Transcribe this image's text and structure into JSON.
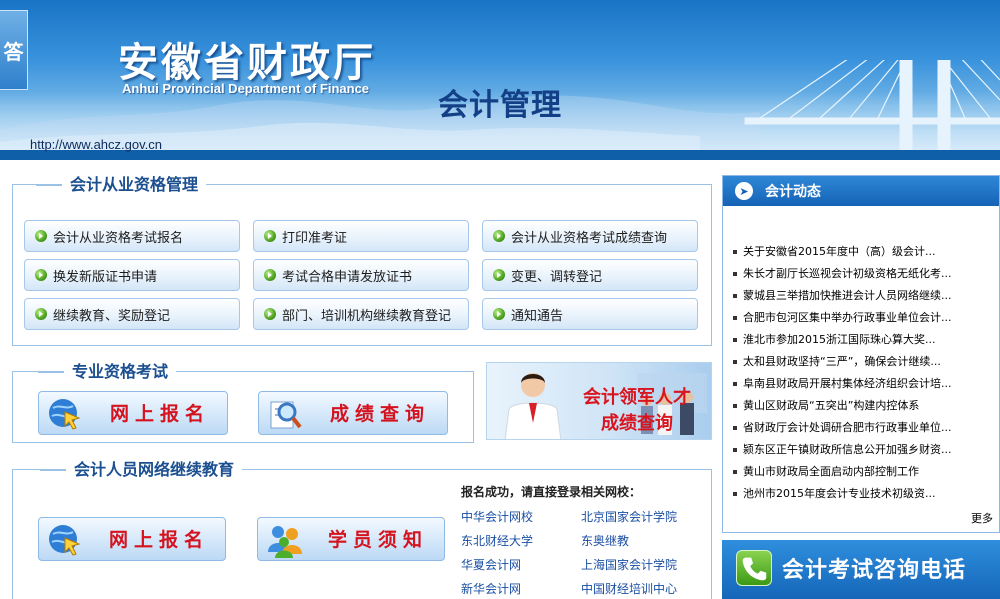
{
  "header": {
    "side_tab": "答",
    "org_title": "安徽省财政厅",
    "org_title_en": "Anhui Provincial Department of Finance",
    "dept_title": "会计管理",
    "url": "http://www.ahcz.gov.cn"
  },
  "qualification": {
    "title": "会计从业资格管理",
    "buttons": [
      "会计从业资格考试报名",
      "打印准考证",
      "会计从业资格考试成绩查询",
      "换发新版证书申请",
      "考试合格申请发放证书",
      "变更、调转登记",
      "继续教育、奖励登记",
      "部门、培训机构继续教育登记",
      "通知通告"
    ]
  },
  "professional": {
    "title": "专业资格考试",
    "register": "网上报名",
    "score": "成绩查询",
    "promo_line1": "会计领军人才",
    "promo_line2": "成绩查询"
  },
  "continuing": {
    "title": "会计人员网络继续教育",
    "register": "网上报名",
    "notice": "学员须知",
    "schools_heading": "报名成功，请直接登录相关网校：",
    "schools": [
      "中华会计网校",
      "北京国家会计学院",
      "东北财经大学",
      "东奥继教",
      "华夏会计网",
      "上海国家会计学院",
      "新华会计网",
      "中国财经培训中心"
    ]
  },
  "news": {
    "title": "会计动态",
    "items": [
      "关于安徽省2015年度中（高）级会计...",
      "朱长才副厅长巡视会计初级资格无纸化考...",
      "蒙城县三举措加快推进会计人员网络继续...",
      "合肥市包河区集中举办行政事业单位会计...",
      "淮北市参加2015浙江国际珠心算大奖...",
      "太和县财政坚持“三严”，确保会计继续...",
      "阜南县财政局开展村集体经济组织会计培...",
      "黄山区财政局“五突出”构建内控体系",
      "省财政厅会计处调研合肥市行政事业单位...",
      "颍东区正午镇财政所信息公开加强乡财资...",
      "黄山市财政局全面启动内部控制工作",
      "池州市2015年度会计专业技术初级资..."
    ],
    "more": "更多"
  },
  "hotline": {
    "label": "会计考试咨询电话"
  }
}
